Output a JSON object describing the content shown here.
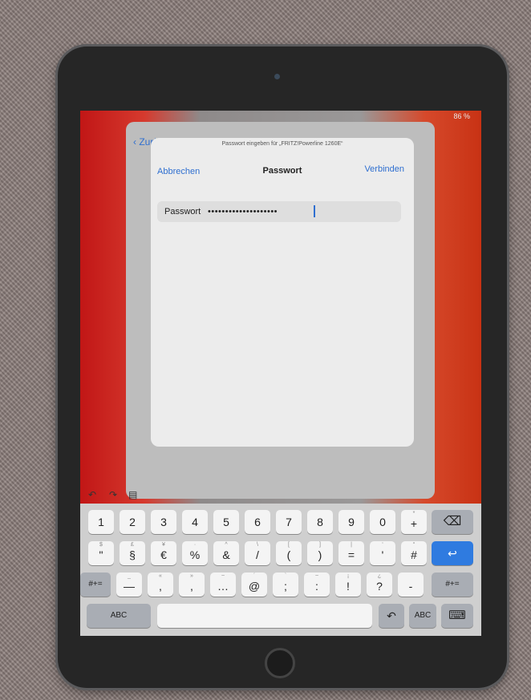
{
  "status_text": "86 %",
  "back_label": "Zurück",
  "prompt": "Passwort eingeben für „FRITZ!Powerline 1260E“",
  "nav": {
    "cancel": "Abbrechen",
    "title": "Passwort",
    "connect": "Verbinden"
  },
  "field": {
    "label": "Passwort",
    "value": "••••••••••••••••••••"
  },
  "toolbar": {
    "undo": "↶",
    "redo": "↷",
    "paste": "▤"
  },
  "keys": {
    "row1": [
      {
        "main": "1",
        "alt": ""
      },
      {
        "main": "2",
        "alt": ""
      },
      {
        "main": "3",
        "alt": ""
      },
      {
        "main": "4",
        "alt": ""
      },
      {
        "main": "5",
        "alt": ""
      },
      {
        "main": "6",
        "alt": ""
      },
      {
        "main": "7",
        "alt": ""
      },
      {
        "main": "8",
        "alt": ""
      },
      {
        "main": "9",
        "alt": ""
      },
      {
        "main": "0",
        "alt": ""
      },
      {
        "main": "+",
        "alt": "*"
      }
    ],
    "delete": "⌫",
    "row2": [
      {
        "main": "\"",
        "alt": "$"
      },
      {
        "main": "§",
        "alt": "£"
      },
      {
        "main": "€",
        "alt": "¥"
      },
      {
        "main": "%",
        "alt": "·"
      },
      {
        "main": "&",
        "alt": "^"
      },
      {
        "main": "/",
        "alt": "\\"
      },
      {
        "main": "(",
        "alt": "["
      },
      {
        "main": ")",
        "alt": "]"
      },
      {
        "main": "=",
        "alt": "|"
      },
      {
        "main": "'",
        "alt": "‘"
      },
      {
        "main": "#",
        "alt": "°"
      }
    ],
    "return": "↩",
    "row3_left": "#+=",
    "row3": [
      {
        "main": "—",
        "alt": "_"
      },
      {
        "main": ",",
        "alt": "«"
      },
      {
        "main": ",",
        "alt": "»"
      },
      {
        "main": "…",
        "alt": "~"
      },
      {
        "main": "@",
        "alt": "´"
      },
      {
        "main": ";",
        "alt": "`"
      },
      {
        "main": ":",
        "alt": "~"
      },
      {
        "main": "!",
        "alt": "¡"
      },
      {
        "main": "?",
        "alt": "¿"
      },
      {
        "main": "-",
        "alt": ""
      }
    ],
    "row3_right": "#+=",
    "abc_left": "ABC",
    "undo_key": "↶",
    "abc_right": "ABC",
    "dismiss": "⌨"
  }
}
